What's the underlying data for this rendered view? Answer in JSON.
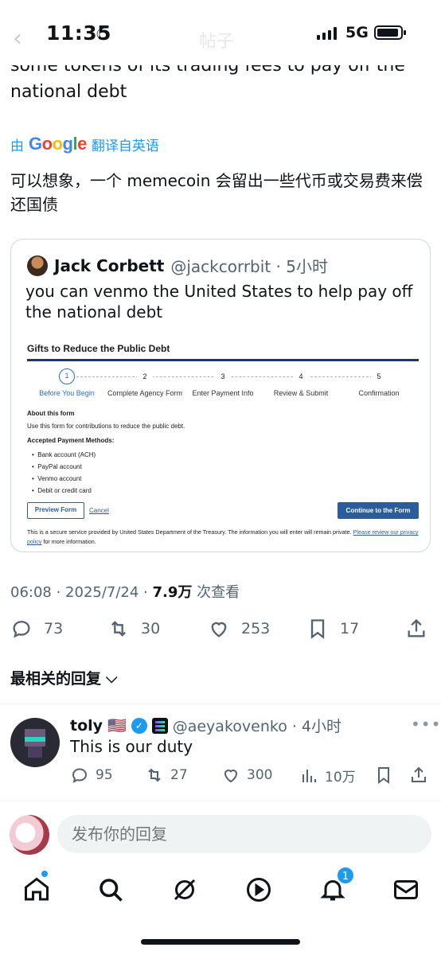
{
  "status_bar": {
    "time": "11:35",
    "network": "5G",
    "nav_title": "帖子"
  },
  "tweet": {
    "text_clip": "some tokens of its trading fees to pay off the",
    "text_line2": "national debt",
    "translated_by": "由",
    "google": "Google",
    "translated_from": "翻译自英语",
    "translation": "可以想象，一个 memecoin 会留出一些代币或交易费来偿还国债",
    "timestamp": "06:08 · 2025/7/24 · ",
    "views": "7.9万",
    "views_label": " 次查看",
    "replies": "73",
    "retweets": "30",
    "likes": "253",
    "bookmarks": "17"
  },
  "quote": {
    "name": "Jack Corbett",
    "handle": "@jackcorrbit · 5小时",
    "text": "you can venmo the United States to help pay off the national debt",
    "form": {
      "title": "Gifts to Reduce the Public Debt",
      "steps": [
        {
          "num": "1",
          "label": "Before You Begin"
        },
        {
          "num": "2",
          "label": "Complete Agency Form"
        },
        {
          "num": "3",
          "label": "Enter Payment Info"
        },
        {
          "num": "4",
          "label": "Review & Submit"
        },
        {
          "num": "5",
          "label": "Confirmation"
        }
      ],
      "about_title": "About this form",
      "about_text": "Use this form for contributions to reduce the public debt.",
      "methods_title": "Accepted Payment Methods:",
      "methods": [
        "Bank account (ACH)",
        "PayPal account",
        "Venmo account",
        "Debit or credit card"
      ],
      "preview_button": "Preview Form",
      "cancel_link": "Cancel",
      "continue_button": "Continue to the Form",
      "note": "This is a secure service provided by United States Department of the Treasury. The information you will enter will remain private. ",
      "note_link": "Please review our privacy policy",
      "note_end": " for more information."
    }
  },
  "sort_label": "最相关的回复",
  "reply": {
    "name": "toly",
    "handle": "@aeyakovenko · 4小时",
    "text": "This is our duty",
    "replies": "95",
    "retweets": "27",
    "likes": "300",
    "views": "10万"
  },
  "composer": {
    "placeholder": "发布你的回复"
  },
  "notifications_badge": "1",
  "colors": {
    "accent": "#1d9bf0",
    "text": "#0f1419",
    "secondary": "#536471"
  }
}
